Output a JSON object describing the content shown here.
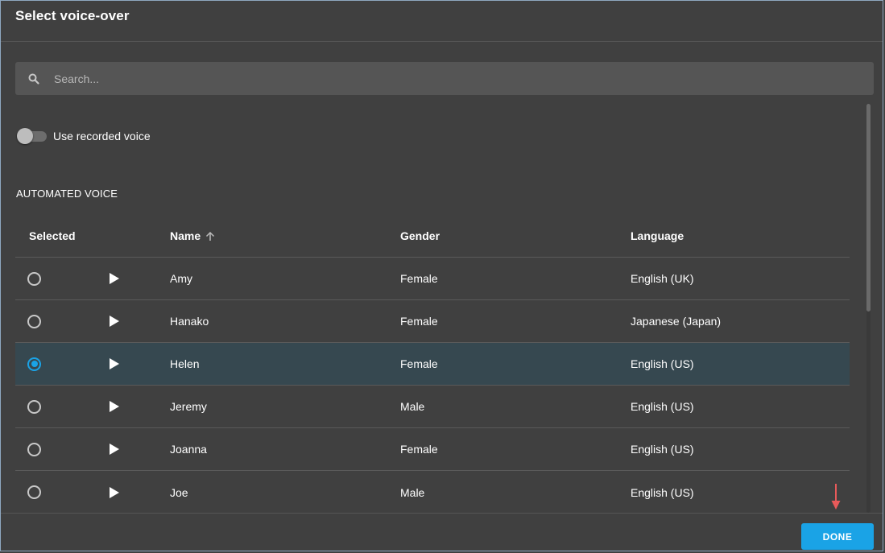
{
  "dialog": {
    "title": "Select voice-over"
  },
  "search": {
    "placeholder": "Search...",
    "value": ""
  },
  "toggle": {
    "label": "Use recorded voice",
    "on": false
  },
  "section": {
    "title": "AUTOMATED VOICE"
  },
  "table": {
    "headers": {
      "selected": "Selected",
      "name": "Name",
      "gender": "Gender",
      "language": "Language"
    },
    "sort": {
      "column": "name",
      "direction": "ascending"
    },
    "rows": [
      {
        "name": "Amy",
        "gender": "Female",
        "language": "English (UK)",
        "selected": false
      },
      {
        "name": "Hanako",
        "gender": "Female",
        "language": "Japanese (Japan)",
        "selected": false
      },
      {
        "name": "Helen",
        "gender": "Female",
        "language": "English (US)",
        "selected": true
      },
      {
        "name": "Jeremy",
        "gender": "Male",
        "language": "English (US)",
        "selected": false
      },
      {
        "name": "Joanna",
        "gender": "Female",
        "language": "English (US)",
        "selected": false
      },
      {
        "name": "Joe",
        "gender": "Male",
        "language": "English (US)",
        "selected": false
      }
    ]
  },
  "footer": {
    "done_label": "DONE"
  },
  "colors": {
    "background": "#404040",
    "accent": "#1aa3e6",
    "selected_row": "#364850",
    "annotation_arrow": "#e85a5a"
  },
  "icons": {
    "search": "search-icon",
    "play": "play-icon",
    "sort": "arrow-up-icon",
    "annotation": "arrow-down-icon"
  }
}
